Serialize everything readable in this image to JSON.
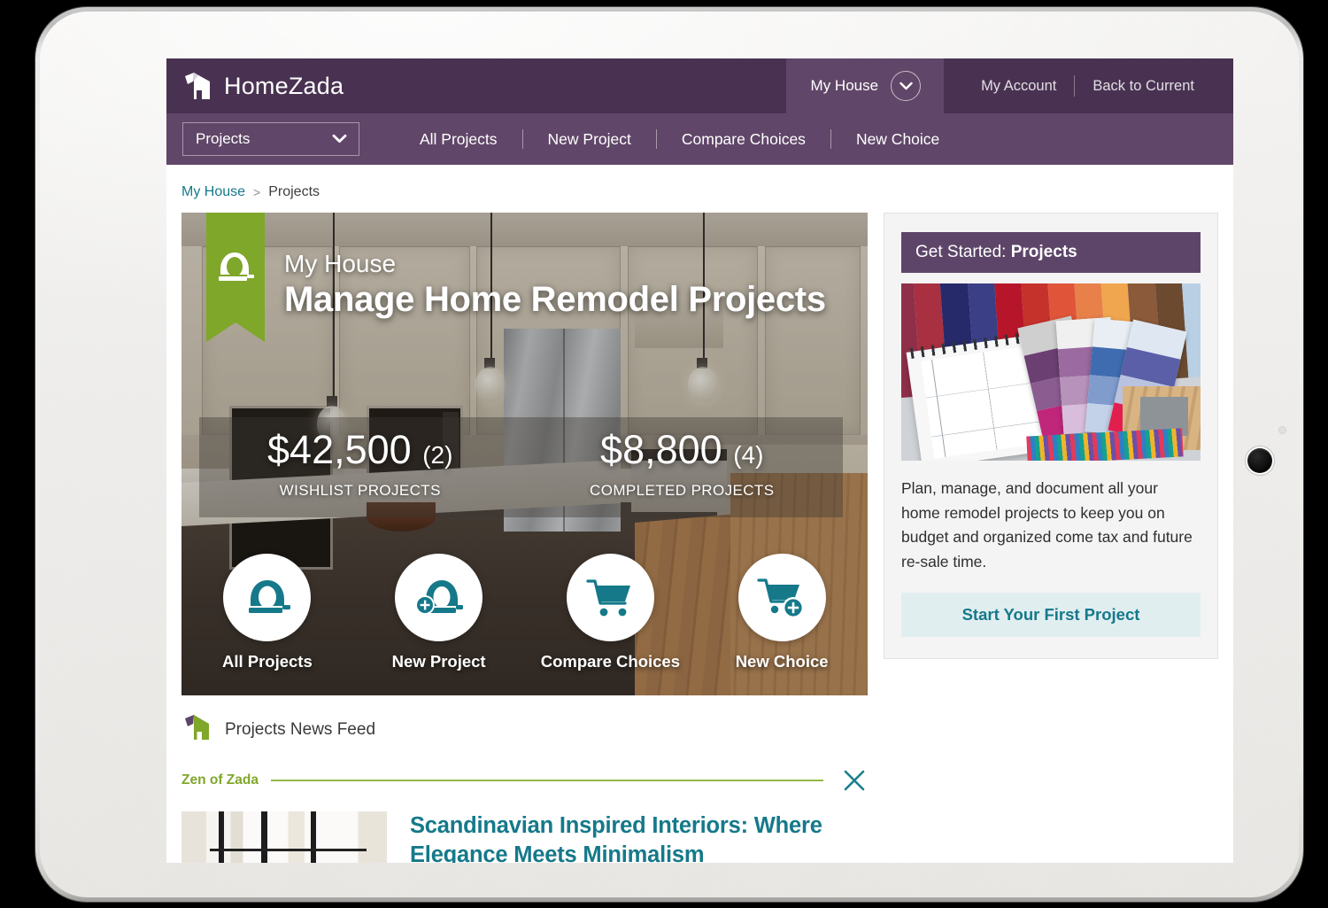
{
  "brand": {
    "name": "HomeZada",
    "logo_icon": "homezada-house-flag-logo"
  },
  "topbar": {
    "house_switch_label": "My House",
    "house_switch_icon": "chevron-down-icon",
    "my_account_label": "My Account",
    "back_to_current_label": "Back to Current"
  },
  "navbar": {
    "select_value": "Projects",
    "select_icon": "chevron-down-icon",
    "links": [
      {
        "label": "All Projects"
      },
      {
        "label": "New Project"
      },
      {
        "label": "Compare Choices"
      },
      {
        "label": "New Choice"
      }
    ]
  },
  "breadcrumb": {
    "home": "My House",
    "separator": ">",
    "current": "Projects"
  },
  "hero": {
    "ribbon_icon": "tape-measure-icon",
    "eyebrow": "My House",
    "title": "Manage Home Remodel Projects",
    "stats": [
      {
        "value": "$42,500",
        "count": "(2)",
        "label": "WISHLIST PROJECTS"
      },
      {
        "value": "$8,800",
        "count": "(4)",
        "label": "COMPLETED PROJECTS"
      }
    ],
    "actions": [
      {
        "label": "All Projects",
        "icon": "tape-measure-icon"
      },
      {
        "label": "New Project",
        "icon": "tape-measure-plus-icon"
      },
      {
        "label": "Compare Choices",
        "icon": "shopping-cart-icon"
      },
      {
        "label": "New Choice",
        "icon": "shopping-cart-plus-icon"
      }
    ]
  },
  "get_started": {
    "header_prefix": "Get Started: ",
    "header_highlight": "Projects",
    "image_alt": "color-swatches-and-sketchpad-photo",
    "body": "Plan, manage, and document all your home remodel projects to keep you on budget and organized come tax and future re-sale time.",
    "button_label": "Start Your First Project"
  },
  "news_feed": {
    "icon": "homezada-green-house-icon",
    "title": "Projects News Feed",
    "section_label": "Zen of Zada",
    "close_icon": "close-icon",
    "article": {
      "thumb_alt": "window-with-curtains-photo",
      "title": "Scandinavian Inspired Interiors: Where Elegance Meets Minimalism"
    }
  },
  "device": {
    "home_button_icon": "home-button",
    "sensor_icon": "sensor-dot"
  },
  "colors": {
    "purple_dark": "#493251",
    "purple": "#604668",
    "purple_panel": "#5d4569",
    "teal": "#15798a",
    "teal_soft_bg": "#e1eef0",
    "green": "#7fa72a"
  }
}
